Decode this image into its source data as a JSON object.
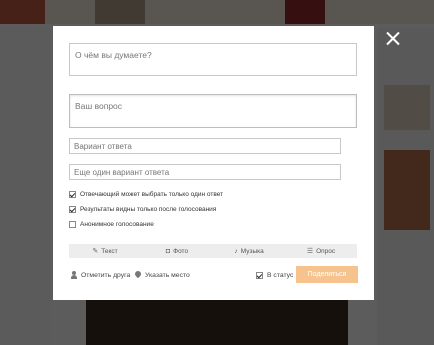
{
  "post_form": {
    "thought_placeholder": "О чём вы думаете?",
    "question_placeholder": "Ваш вопрос",
    "answer_placeholder": "Вариант ответа",
    "another_answer_placeholder": "Еще один вариант ответа"
  },
  "options": [
    {
      "label": "Отвечающий может выбрать только один ответ",
      "checked": true
    },
    {
      "label": "Результаты видны только после голосования",
      "checked": true
    },
    {
      "label": "Анонимное голосование",
      "checked": false
    }
  ],
  "tabs": [
    {
      "label": "Текст",
      "icon": "pencil-icon",
      "glyph": "✎"
    },
    {
      "label": "Фото",
      "icon": "camera-icon",
      "glyph": "📷"
    },
    {
      "label": "Музыка",
      "icon": "music-note-icon",
      "glyph": "♪"
    },
    {
      "label": "Опрос",
      "icon": "poll-icon",
      "glyph": "☰"
    }
  ],
  "footer": {
    "tag_friend_label": "Отметить друга",
    "location_label": "Указать место",
    "status_label": "В статус",
    "status_checked": true,
    "share_label": "Поделиться"
  },
  "colors": {
    "accent_button": "#f6c38f",
    "overlay": "rgba(0,0,0,0.62)"
  }
}
